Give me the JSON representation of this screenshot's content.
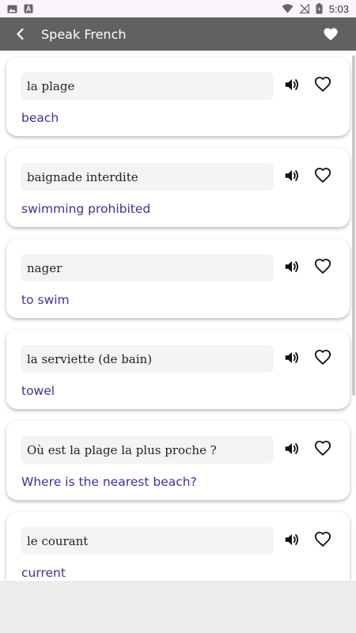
{
  "status": {
    "time": "5:03"
  },
  "header": {
    "title": "Speak French"
  },
  "cards": [
    {
      "phrase": "la plage",
      "translation": "beach"
    },
    {
      "phrase": "baignade interdite",
      "translation": "swimming prohibited"
    },
    {
      "phrase": "nager",
      "translation": "to swim"
    },
    {
      "phrase": "la serviette (de bain)",
      "translation": "towel"
    },
    {
      "phrase": "Où est la plage la plus proche ?",
      "translation": "Where is the nearest beach?"
    },
    {
      "phrase": "le courant",
      "translation": "current"
    }
  ],
  "colors": {
    "appbar": "#616161",
    "translation": "#4a2d94",
    "phrase_bg": "#f4f4f4"
  },
  "icons": {
    "back": "chevron-left-icon",
    "favorites": "heart-filled-icon",
    "speak": "speaker-icon",
    "favorite": "heart-outline-icon"
  }
}
